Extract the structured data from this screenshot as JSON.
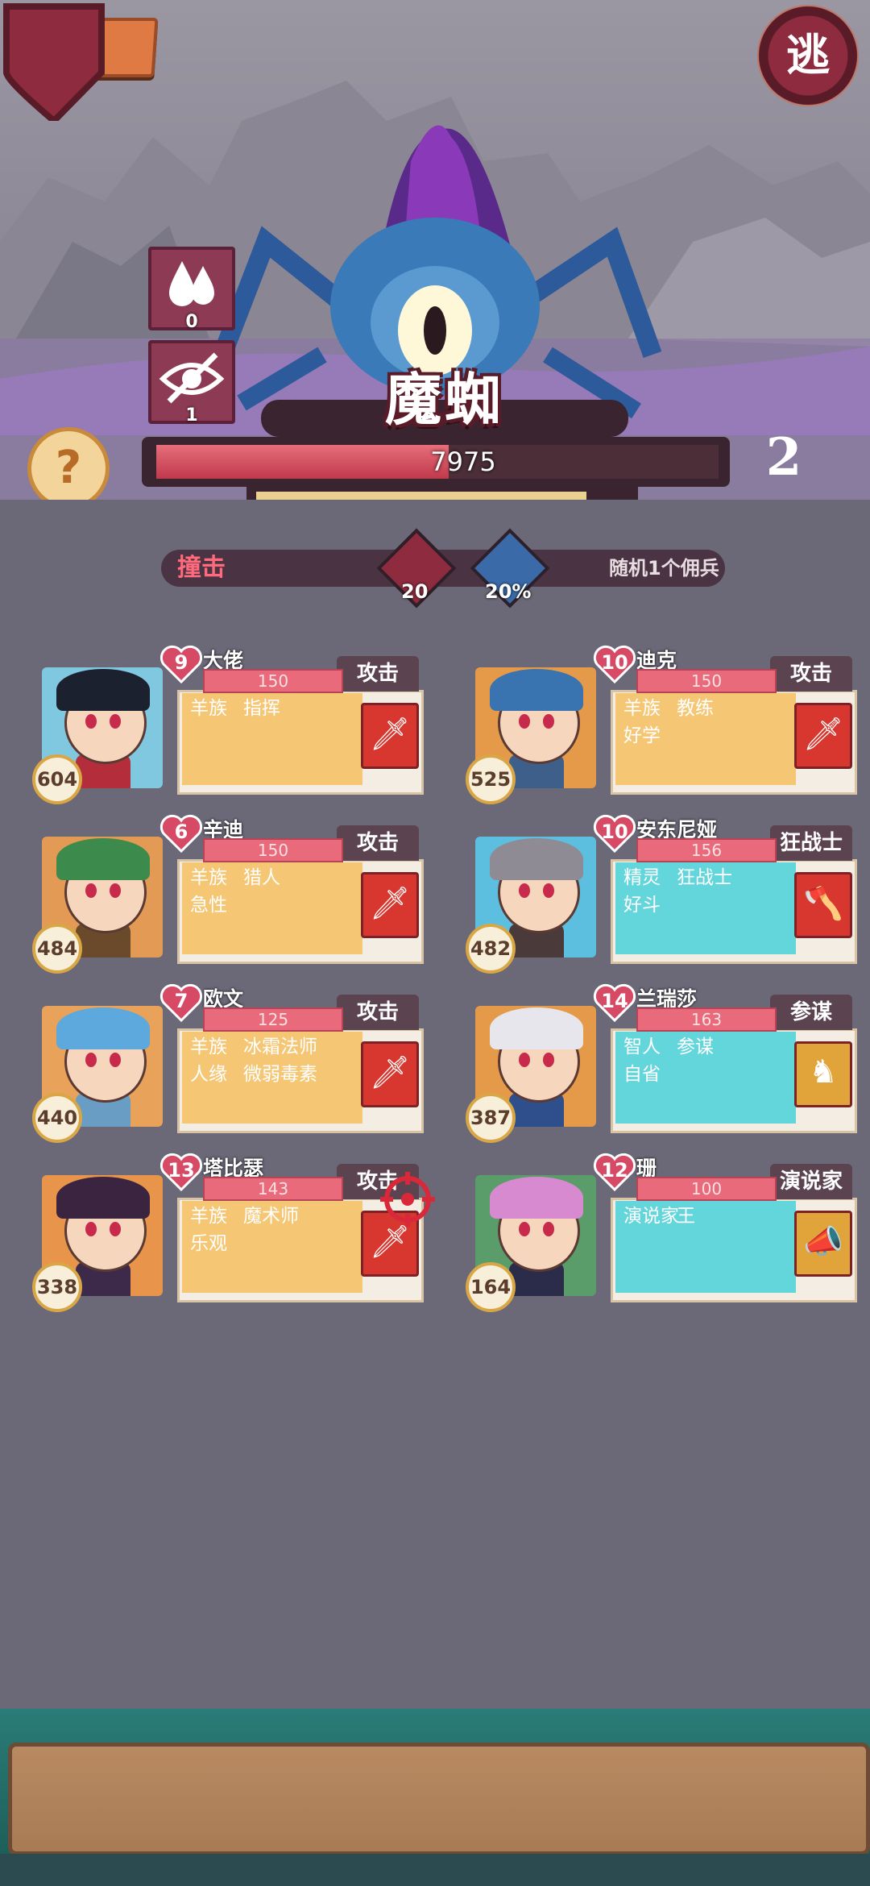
{
  "top_bar": {
    "next_label": ">",
    "flee_label": "逃"
  },
  "boss": {
    "name": "魔蜘",
    "hp": "7975",
    "hp_fraction": 0.52,
    "sub_bar_fraction": 0.88,
    "level": "2",
    "status_effects": [
      {
        "icon": "drops-icon",
        "count": "0"
      },
      {
        "icon": "eye-off-icon",
        "count": "1"
      }
    ],
    "help_label": "?"
  },
  "boss_action": {
    "name": "撞击",
    "damage": "20",
    "chance": "20%",
    "target": "随机1个佣兵",
    "damage_icon": "sword-icon",
    "chance_icon": "bird-icon"
  },
  "mercenaries": [
    {
      "name": "大佬",
      "level": "9",
      "hp": "150",
      "role": "攻击",
      "power": "604",
      "traits": [
        "羊族",
        "指挥"
      ],
      "traits2": [],
      "panel_color": "#f5c774",
      "portrait_color": "#7fc8e0",
      "hat_color": "#1c2130",
      "body_color": "#b32d3a",
      "skill_color": "#d8372f",
      "skill_icon": "sword-icon"
    },
    {
      "name": "迪克",
      "level": "10",
      "hp": "150",
      "role": "攻击",
      "power": "525",
      "traits": [
        "羊族",
        "教练"
      ],
      "traits2": [
        "好学"
      ],
      "panel_color": "#f5c774",
      "portrait_color": "#e59a4a",
      "hat_color": "#3a74b0",
      "body_color": "#3d5f8a",
      "skill_color": "#d8372f",
      "skill_icon": "sword-icon"
    },
    {
      "name": "辛迪",
      "level": "6",
      "hp": "150",
      "role": "攻击",
      "power": "484",
      "traits": [
        "羊族",
        "猎人"
      ],
      "traits2": [
        "急性"
      ],
      "panel_color": "#f5c774",
      "portrait_color": "#e29a55",
      "hat_color": "#3d8a4d",
      "body_color": "#6b4a2b",
      "skill_color": "#d8372f",
      "skill_icon": "sword-icon"
    },
    {
      "name": "安东尼娅",
      "level": "10",
      "hp": "156",
      "role": "狂战士",
      "power": "482",
      "traits": [
        "精灵",
        "狂战士"
      ],
      "traits2": [
        "好斗"
      ],
      "panel_color": "#63d6dc",
      "portrait_color": "#5cbfe0",
      "hat_color": "#8f8b94",
      "body_color": "#4a3a3a",
      "skill_color": "#d8372f",
      "skill_icon": "axe-icon"
    },
    {
      "name": "欧文",
      "level": "7",
      "hp": "125",
      "role": "攻击",
      "power": "440",
      "traits": [
        "羊族",
        "冰霜法师"
      ],
      "traits2": [
        "人缘",
        "微弱毒素"
      ],
      "panel_color": "#f5c774",
      "portrait_color": "#e8a25a",
      "hat_color": "#5da8dc",
      "body_color": "#6a9dc4",
      "skill_color": "#d8372f",
      "skill_icon": "sword-icon"
    },
    {
      "name": "兰瑞莎",
      "level": "14",
      "hp": "163",
      "role": "参谋",
      "power": "387",
      "traits": [
        "智人",
        "参谋"
      ],
      "traits2": [
        "自省"
      ],
      "panel_color": "#63d6dc",
      "portrait_color": "#e59a4a",
      "hat_color": "#e6e6ec",
      "body_color": "#2e4f8c",
      "skill_color": "#e1a43a",
      "skill_icon": "chess-icon"
    },
    {
      "name": "塔比瑟",
      "level": "13",
      "hp": "143",
      "role": "攻击",
      "power": "338",
      "traits": [
        "羊族",
        "魔术师"
      ],
      "traits2": [
        "乐观"
      ],
      "panel_color": "#f5c774",
      "portrait_color": "#e8944a",
      "hat_color": "#3a2440",
      "body_color": "#3d2a4a",
      "skill_color": "#d8372f",
      "skill_icon": "sword-icon"
    },
    {
      "name": "珊",
      "level": "12",
      "hp": "100",
      "role": "演说家",
      "power": "164",
      "traits": [
        "演说家",
        "王"
      ],
      "traits2": [],
      "panel_color": "#63d6dc",
      "portrait_color": "#5a9c6a",
      "hat_color": "#d88ad0",
      "body_color": "#2a2c4a",
      "skill_color": "#e1a43a",
      "skill_icon": "megaphone-icon"
    }
  ]
}
